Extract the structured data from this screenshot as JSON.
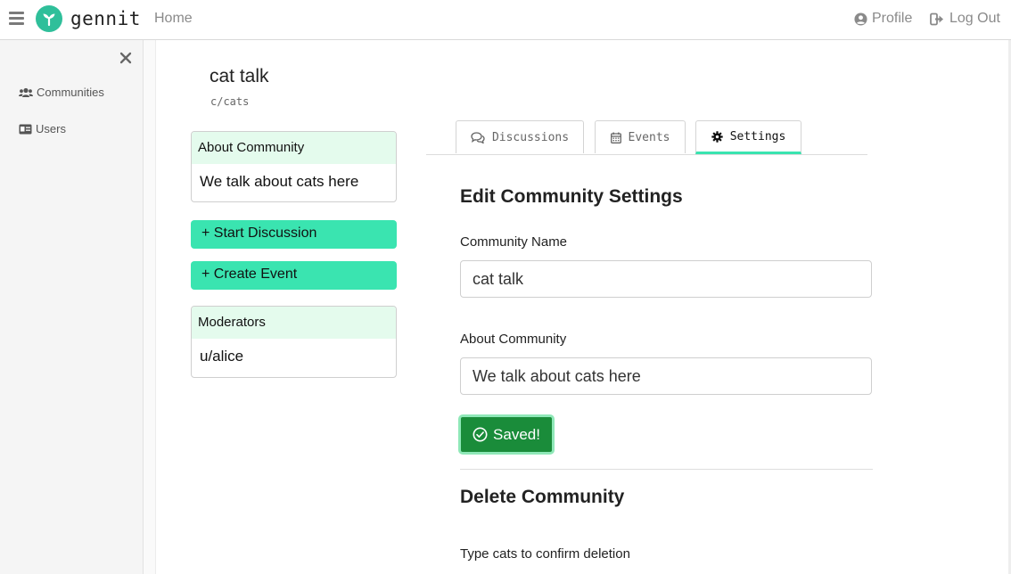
{
  "app": {
    "logo_text": "gennit",
    "accent_color": "#3ae4b0",
    "logo_color": "#2fbf9a"
  },
  "header": {
    "home_label": "Home",
    "profile_label": "Profile",
    "logout_label": "Log Out"
  },
  "sidebar": {
    "items": [
      {
        "label": "Communities",
        "icon": "users-icon"
      },
      {
        "label": "Users",
        "icon": "id-card-icon"
      }
    ]
  },
  "community": {
    "title": "cat talk",
    "slug": "c/cats",
    "about_heading": "About Community",
    "about_text": "We talk about cats here",
    "start_discussion_label": "+ Start Discussion",
    "create_event_label": "+ Create Event",
    "moderators_heading": "Moderators",
    "moderator": "u/alice"
  },
  "tabs": [
    {
      "label": "Discussions",
      "icon": "comments-icon",
      "active": false
    },
    {
      "label": "Events",
      "icon": "calendar-icon",
      "active": false
    },
    {
      "label": "Settings",
      "icon": "gear-icon",
      "active": true
    }
  ],
  "settings": {
    "edit_heading": "Edit Community Settings",
    "name_label": "Community Name",
    "name_value": "cat talk",
    "about_label": "About Community",
    "about_value": "We talk about cats here",
    "saved_label": "Saved!",
    "delete_heading": "Delete Community",
    "confirm_label": "Type cats to confirm deletion"
  }
}
